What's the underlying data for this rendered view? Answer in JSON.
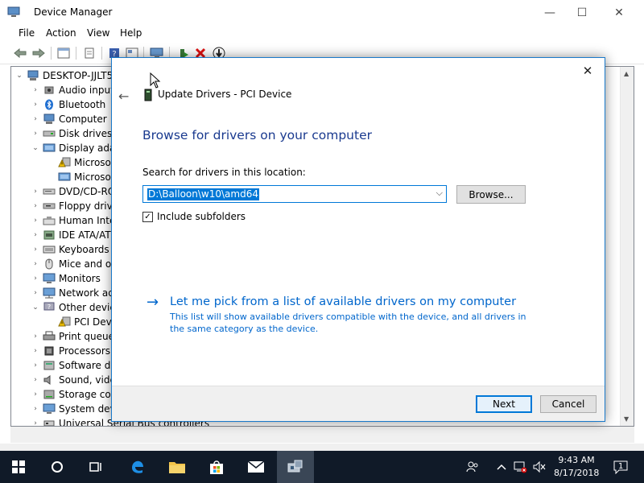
{
  "window": {
    "title": "Device Manager",
    "minimize": "—",
    "maximize": "☐",
    "close": "✕"
  },
  "menu": [
    "File",
    "Action",
    "View",
    "Help"
  ],
  "tree": {
    "root": "DESKTOP-JJLT5",
    "items": [
      {
        "label": "Audio input",
        "expander": "›",
        "icon": "speaker-icon"
      },
      {
        "label": "Bluetooth",
        "expander": "›",
        "icon": "bluetooth-icon"
      },
      {
        "label": "Computer",
        "expander": "›",
        "icon": "computer-icon"
      },
      {
        "label": "Disk drives",
        "expander": "›",
        "icon": "disk-drive-icon"
      },
      {
        "label": "Display ada",
        "expander": "⌄",
        "icon": "display-adapter-icon"
      },
      {
        "label": "Microso",
        "expander": "",
        "icon": "warning-device-icon",
        "child": true
      },
      {
        "label": "Microso",
        "expander": "",
        "icon": "display-adapter-icon",
        "child": true
      },
      {
        "label": "DVD/CD-RO",
        "expander": "›",
        "icon": "dvd-drive-icon"
      },
      {
        "label": "Floppy driv",
        "expander": "›",
        "icon": "floppy-icon"
      },
      {
        "label": "Human Inte",
        "expander": "›",
        "icon": "hid-icon"
      },
      {
        "label": "IDE ATA/AT",
        "expander": "›",
        "icon": "ide-icon"
      },
      {
        "label": "Keyboards",
        "expander": "›",
        "icon": "keyboard-icon"
      },
      {
        "label": "Mice and ot",
        "expander": "›",
        "icon": "mouse-icon"
      },
      {
        "label": "Monitors",
        "expander": "›",
        "icon": "monitor-icon"
      },
      {
        "label": "Network ad",
        "expander": "›",
        "icon": "network-icon"
      },
      {
        "label": "Other devic",
        "expander": "⌄",
        "icon": "other-device-icon"
      },
      {
        "label": "PCI Dev",
        "expander": "",
        "icon": "warning-device-icon",
        "child": true
      },
      {
        "label": "Print queue",
        "expander": "›",
        "icon": "printer-icon"
      },
      {
        "label": "Processors",
        "expander": "›",
        "icon": "processor-icon"
      },
      {
        "label": "Software de",
        "expander": "›",
        "icon": "software-device-icon"
      },
      {
        "label": "Sound, vide",
        "expander": "›",
        "icon": "sound-icon"
      },
      {
        "label": "Storage cor",
        "expander": "›",
        "icon": "storage-icon"
      },
      {
        "label": "System dev",
        "expander": "›",
        "icon": "system-device-icon"
      },
      {
        "label": "Universal Serial Bus controllers",
        "expander": "›",
        "icon": "usb-icon"
      }
    ]
  },
  "dialog": {
    "close": "✕",
    "back": "←",
    "title": "Update Drivers - PCI Device",
    "heading": "Browse for drivers on your computer",
    "search_label": "Search for drivers in this location:",
    "path_value": "D:\\Balloon\\w10\\amd64",
    "browse": "Browse...",
    "include_subfolders": "Include subfolders",
    "include_subfolders_checked": true,
    "check_mark": "✓",
    "pick_arrow": "→",
    "pick_link": "Let me pick from a list of available drivers on my computer",
    "pick_desc": "This list will show available drivers compatible with the device, and all drivers in the same category as the device.",
    "next": "Next",
    "cancel": "Cancel"
  },
  "taskbar": {
    "time": "9:43 AM",
    "date": "8/17/2018",
    "notification_count": "1"
  },
  "colors": {
    "accent": "#0078d7",
    "heading": "#1a3a8f",
    "link": "#0066cc",
    "taskbar": "#101a28"
  }
}
